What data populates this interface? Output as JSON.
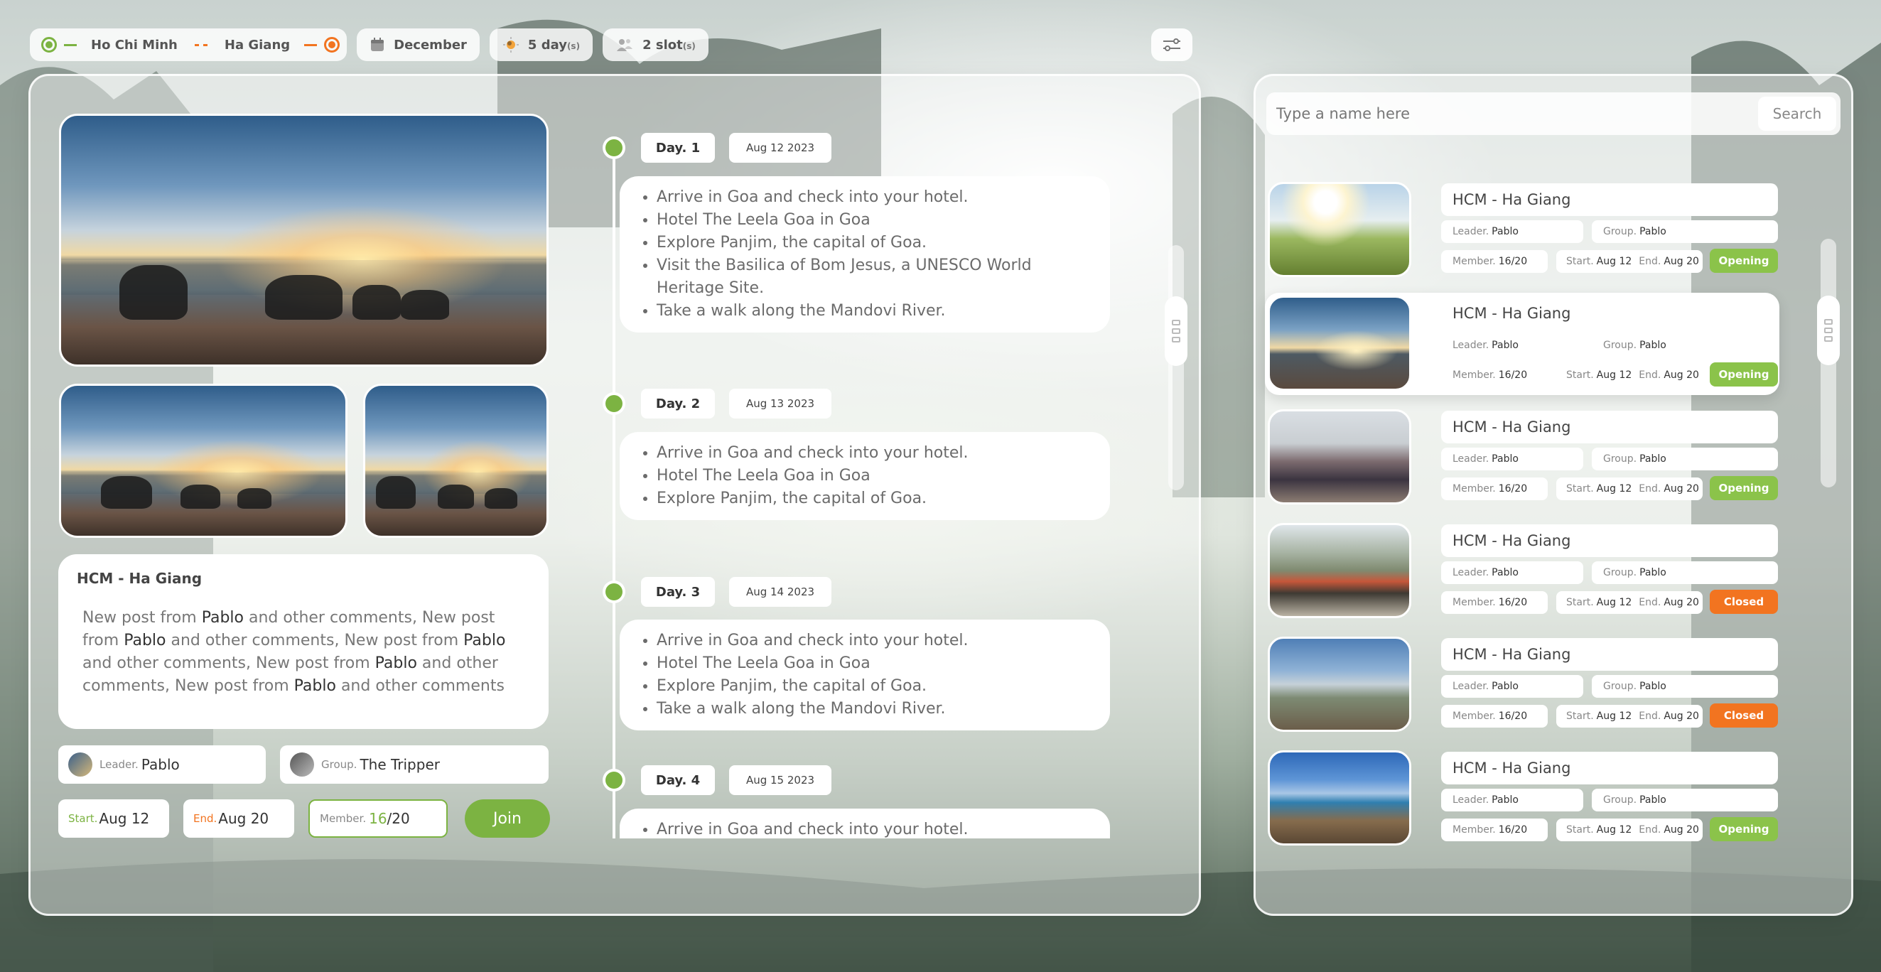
{
  "topbar": {
    "from": "Ho Chi Minh",
    "to": "Ha Giang",
    "month": "December",
    "days_value": "5 day",
    "days_unit": "(s)",
    "slots_value": "2 slot",
    "slots_unit": "(s)"
  },
  "detail": {
    "title": "HCM - Ha Giang",
    "desc_segments": [
      "New post from ",
      "Pablo",
      " and other comments, New post from ",
      "Pablo",
      " and other comments, New post from ",
      "Pablo",
      " and other comments, New post from ",
      "Pablo",
      " and other comments, New post from ",
      "Pablo",
      " and other comments"
    ],
    "leader_label": "Leader.",
    "leader": "Pablo",
    "group_label": "Group.",
    "group": "The Tripper",
    "start_label": "Start.",
    "start": "Aug 12",
    "end_label": "End.",
    "end": "Aug 20",
    "member_label": "Member.",
    "member_current": "16",
    "member_total": "/20",
    "join_label": "Join"
  },
  "timeline": [
    {
      "day": "Day. 1",
      "date": "Aug 12 2023",
      "items": [
        "Arrive in Goa and check into your hotel.",
        "Hotel The Leela Goa in Goa",
        "Explore Panjim, the capital of Goa.",
        "Visit the Basilica of Bom Jesus, a UNESCO World Heritage Site.",
        "Take a walk along the Mandovi River."
      ]
    },
    {
      "day": "Day. 2",
      "date": "Aug 13 2023",
      "items": [
        "Arrive in Goa and check into your hotel.",
        "Hotel The Leela Goa in Goa",
        "Explore Panjim, the capital of Goa."
      ]
    },
    {
      "day": "Day. 3",
      "date": "Aug 14 2023",
      "items": [
        "Arrive in Goa and check into your hotel.",
        "Hotel The Leela Goa in Goa",
        "Explore Panjim, the capital of Goa.",
        "Take a walk along the Mandovi River."
      ]
    },
    {
      "day": "Day. 4",
      "date": "Aug 15 2023",
      "items": [
        "Arrive in Goa and check into your hotel."
      ]
    }
  ],
  "search": {
    "placeholder": "Type a name here",
    "button": "Search"
  },
  "trip_labels": {
    "leader": "Leader.",
    "group": "Group.",
    "member": "Member.",
    "start": "Start.",
    "end": "End."
  },
  "trips": [
    {
      "title": "HCM - Ha Giang",
      "leader": "Pablo",
      "group": "Pablo",
      "member": "16/20",
      "start": "Aug 12",
      "end": "Aug 20",
      "status": "Opening"
    },
    {
      "title": "HCM - Ha Giang",
      "leader": "Pablo",
      "group": "Pablo",
      "member": "16/20",
      "start": "Aug 12",
      "end": "Aug 20",
      "status": "Opening"
    },
    {
      "title": "HCM - Ha Giang",
      "leader": "Pablo",
      "group": "Pablo",
      "member": "16/20",
      "start": "Aug 12",
      "end": "Aug 20",
      "status": "Opening"
    },
    {
      "title": "HCM - Ha Giang",
      "leader": "Pablo",
      "group": "Pablo",
      "member": "16/20",
      "start": "Aug 12",
      "end": "Aug 20",
      "status": "Closed"
    },
    {
      "title": "HCM - Ha Giang",
      "leader": "Pablo",
      "group": "Pablo",
      "member": "16/20",
      "start": "Aug 12",
      "end": "Aug 20",
      "status": "Closed"
    },
    {
      "title": "HCM - Ha Giang",
      "leader": "Pablo",
      "group": "Pablo",
      "member": "16/20",
      "start": "Aug 12",
      "end": "Aug 20",
      "status": "Opening"
    }
  ],
  "colors": {
    "accent_green": "#7cb342",
    "accent_orange": "#f27420",
    "open_badge": "#8bc34a",
    "closed_badge": "#f27420"
  },
  "icons": {
    "calendar": "calendar-icon",
    "sun": "sun-icon",
    "group": "group-icon",
    "filter": "filter-icon"
  }
}
